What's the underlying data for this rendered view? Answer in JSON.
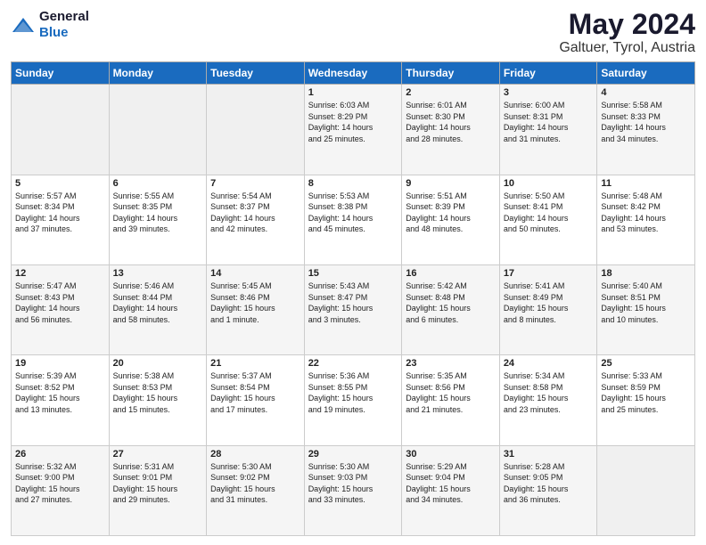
{
  "header": {
    "logo_general": "General",
    "logo_blue": "Blue",
    "month": "May 2024",
    "location": "Galtuer, Tyrol, Austria"
  },
  "weekdays": [
    "Sunday",
    "Monday",
    "Tuesday",
    "Wednesday",
    "Thursday",
    "Friday",
    "Saturday"
  ],
  "weeks": [
    [
      {
        "day": "",
        "info": ""
      },
      {
        "day": "",
        "info": ""
      },
      {
        "day": "",
        "info": ""
      },
      {
        "day": "1",
        "info": "Sunrise: 6:03 AM\nSunset: 8:29 PM\nDaylight: 14 hours\nand 25 minutes."
      },
      {
        "day": "2",
        "info": "Sunrise: 6:01 AM\nSunset: 8:30 PM\nDaylight: 14 hours\nand 28 minutes."
      },
      {
        "day": "3",
        "info": "Sunrise: 6:00 AM\nSunset: 8:31 PM\nDaylight: 14 hours\nand 31 minutes."
      },
      {
        "day": "4",
        "info": "Sunrise: 5:58 AM\nSunset: 8:33 PM\nDaylight: 14 hours\nand 34 minutes."
      }
    ],
    [
      {
        "day": "5",
        "info": "Sunrise: 5:57 AM\nSunset: 8:34 PM\nDaylight: 14 hours\nand 37 minutes."
      },
      {
        "day": "6",
        "info": "Sunrise: 5:55 AM\nSunset: 8:35 PM\nDaylight: 14 hours\nand 39 minutes."
      },
      {
        "day": "7",
        "info": "Sunrise: 5:54 AM\nSunset: 8:37 PM\nDaylight: 14 hours\nand 42 minutes."
      },
      {
        "day": "8",
        "info": "Sunrise: 5:53 AM\nSunset: 8:38 PM\nDaylight: 14 hours\nand 45 minutes."
      },
      {
        "day": "9",
        "info": "Sunrise: 5:51 AM\nSunset: 8:39 PM\nDaylight: 14 hours\nand 48 minutes."
      },
      {
        "day": "10",
        "info": "Sunrise: 5:50 AM\nSunset: 8:41 PM\nDaylight: 14 hours\nand 50 minutes."
      },
      {
        "day": "11",
        "info": "Sunrise: 5:48 AM\nSunset: 8:42 PM\nDaylight: 14 hours\nand 53 minutes."
      }
    ],
    [
      {
        "day": "12",
        "info": "Sunrise: 5:47 AM\nSunset: 8:43 PM\nDaylight: 14 hours\nand 56 minutes."
      },
      {
        "day": "13",
        "info": "Sunrise: 5:46 AM\nSunset: 8:44 PM\nDaylight: 14 hours\nand 58 minutes."
      },
      {
        "day": "14",
        "info": "Sunrise: 5:45 AM\nSunset: 8:46 PM\nDaylight: 15 hours\nand 1 minute."
      },
      {
        "day": "15",
        "info": "Sunrise: 5:43 AM\nSunset: 8:47 PM\nDaylight: 15 hours\nand 3 minutes."
      },
      {
        "day": "16",
        "info": "Sunrise: 5:42 AM\nSunset: 8:48 PM\nDaylight: 15 hours\nand 6 minutes."
      },
      {
        "day": "17",
        "info": "Sunrise: 5:41 AM\nSunset: 8:49 PM\nDaylight: 15 hours\nand 8 minutes."
      },
      {
        "day": "18",
        "info": "Sunrise: 5:40 AM\nSunset: 8:51 PM\nDaylight: 15 hours\nand 10 minutes."
      }
    ],
    [
      {
        "day": "19",
        "info": "Sunrise: 5:39 AM\nSunset: 8:52 PM\nDaylight: 15 hours\nand 13 minutes."
      },
      {
        "day": "20",
        "info": "Sunrise: 5:38 AM\nSunset: 8:53 PM\nDaylight: 15 hours\nand 15 minutes."
      },
      {
        "day": "21",
        "info": "Sunrise: 5:37 AM\nSunset: 8:54 PM\nDaylight: 15 hours\nand 17 minutes."
      },
      {
        "day": "22",
        "info": "Sunrise: 5:36 AM\nSunset: 8:55 PM\nDaylight: 15 hours\nand 19 minutes."
      },
      {
        "day": "23",
        "info": "Sunrise: 5:35 AM\nSunset: 8:56 PM\nDaylight: 15 hours\nand 21 minutes."
      },
      {
        "day": "24",
        "info": "Sunrise: 5:34 AM\nSunset: 8:58 PM\nDaylight: 15 hours\nand 23 minutes."
      },
      {
        "day": "25",
        "info": "Sunrise: 5:33 AM\nSunset: 8:59 PM\nDaylight: 15 hours\nand 25 minutes."
      }
    ],
    [
      {
        "day": "26",
        "info": "Sunrise: 5:32 AM\nSunset: 9:00 PM\nDaylight: 15 hours\nand 27 minutes."
      },
      {
        "day": "27",
        "info": "Sunrise: 5:31 AM\nSunset: 9:01 PM\nDaylight: 15 hours\nand 29 minutes."
      },
      {
        "day": "28",
        "info": "Sunrise: 5:30 AM\nSunset: 9:02 PM\nDaylight: 15 hours\nand 31 minutes."
      },
      {
        "day": "29",
        "info": "Sunrise: 5:30 AM\nSunset: 9:03 PM\nDaylight: 15 hours\nand 33 minutes."
      },
      {
        "day": "30",
        "info": "Sunrise: 5:29 AM\nSunset: 9:04 PM\nDaylight: 15 hours\nand 34 minutes."
      },
      {
        "day": "31",
        "info": "Sunrise: 5:28 AM\nSunset: 9:05 PM\nDaylight: 15 hours\nand 36 minutes."
      },
      {
        "day": "",
        "info": ""
      }
    ]
  ]
}
